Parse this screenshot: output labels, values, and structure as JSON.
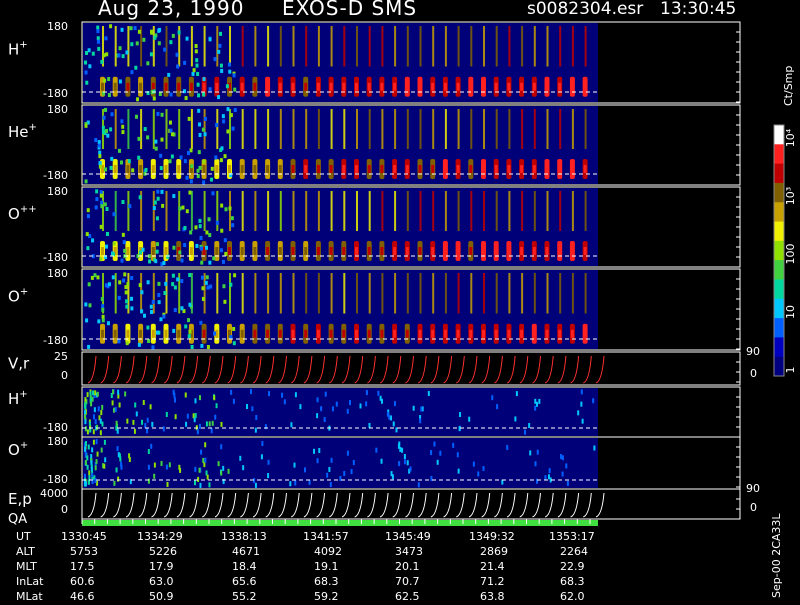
{
  "header": {
    "date": "Aug 23, 1990",
    "instrument": "EXOS-D SMS",
    "file": "s0082304.esr",
    "time": "13:30:45"
  },
  "colorbar": {
    "unit": "Ct/Smp",
    "labels": [
      "1",
      "10",
      "100",
      "10³",
      "10⁴"
    ],
    "colors": [
      "#000080",
      "#0000c0",
      "#0060ff",
      "#00c8ff",
      "#00d8a0",
      "#40d040",
      "#90e000",
      "#f0f000",
      "#c8a000",
      "#806000",
      "#c00000",
      "#ff2020",
      "#ffffff"
    ]
  },
  "panels": [
    {
      "id": "h-plus",
      "label": "H",
      "sup": "+",
      "top_tick": "180",
      "bottom_tick": "-180"
    },
    {
      "id": "he-plus",
      "label": "He",
      "sup": "+",
      "top_tick": "180",
      "bottom_tick": "-180"
    },
    {
      "id": "o-plusplus",
      "label": "O",
      "sup": "++",
      "top_tick": "180",
      "bottom_tick": "-180"
    },
    {
      "id": "o-plus",
      "label": "O",
      "sup": "+",
      "top_tick": "180",
      "bottom_tick": "-180"
    },
    {
      "id": "vr",
      "label": "V,r",
      "sup": "",
      "top_tick": "25",
      "bottom_tick": "0",
      "right_top": "90",
      "right_bottom": "0"
    },
    {
      "id": "h-plus-2",
      "label": "H",
      "sup": "+",
      "top_tick": "",
      "bottom_tick": "-180"
    },
    {
      "id": "o-plus-2",
      "label": "O",
      "sup": "+",
      "top_tick": "180",
      "bottom_tick": "-180"
    },
    {
      "id": "ep",
      "label": "E,p",
      "sup": "",
      "top_tick": "4000",
      "bottom_tick": "0",
      "right_top": "90",
      "right_bottom": "0"
    }
  ],
  "qa_label": "QA",
  "axis_table": {
    "rows": [
      {
        "label": "UT",
        "values": [
          "1330:45",
          "1334:29",
          "1338:13",
          "1341:57",
          "1345:49",
          "1349:32",
          "1353:17"
        ]
      },
      {
        "label": "ALT",
        "values": [
          "5753",
          "5226",
          "4671",
          "4092",
          "3473",
          "2869",
          "2264"
        ]
      },
      {
        "label": "MLT",
        "values": [
          "17.5",
          "17.9",
          "18.4",
          "19.1",
          "20.1",
          "21.4",
          "22.9"
        ]
      },
      {
        "label": "InLat",
        "values": [
          "60.6",
          "63.0",
          "65.6",
          "68.3",
          "70.7",
          "71.2",
          "68.3"
        ]
      },
      {
        "label": "MLat",
        "values": [
          "46.6",
          "50.9",
          "55.2",
          "59.2",
          "62.5",
          "63.8",
          "62.0"
        ]
      }
    ]
  },
  "footer_code": "Sep-00  2CA33L",
  "chart_data": {
    "type": "heatmap",
    "title": "Aug 23, 1990   EXOS-D SMS",
    "x": [
      "1330:45",
      "1334:29",
      "1338:13",
      "1341:57",
      "1345:49",
      "1349:32",
      "1353:17"
    ],
    "series": [
      {
        "name": "H+",
        "ylim": [
          -180,
          180
        ]
      },
      {
        "name": "He+",
        "ylim": [
          -180,
          180
        ]
      },
      {
        "name": "O++",
        "ylim": [
          -180,
          180
        ]
      },
      {
        "name": "O+",
        "ylim": [
          -180,
          180
        ]
      },
      {
        "name": "V,r",
        "ylim": [
          0,
          25
        ]
      },
      {
        "name": "H+",
        "ylim": [
          -180,
          180
        ]
      },
      {
        "name": "O+",
        "ylim": [
          -180,
          180
        ]
      },
      {
        "name": "E,p",
        "ylim": [
          0,
          4000
        ]
      }
    ],
    "colorscale": {
      "unit": "Ct/Smp",
      "range": [
        1,
        10000
      ],
      "log": true
    }
  }
}
